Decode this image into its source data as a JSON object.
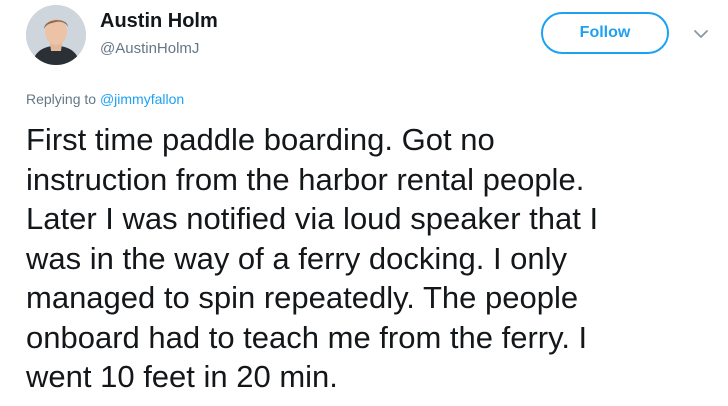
{
  "author": {
    "display_name": "Austin Holm",
    "handle": "@AustinHolmJ",
    "avatar_icon": "profile-photo"
  },
  "actions": {
    "follow_label": "Follow",
    "menu_icon": "chevron-down-icon"
  },
  "reply": {
    "prefix": "Replying to ",
    "mention": "@jimmyfallon"
  },
  "tweet": {
    "lines": [
      "First time paddle boarding. Got no",
      "instruction from the harbor rental people.",
      "Later I was notified via loud speaker that I",
      "was in the way of a ferry docking. I only",
      "managed to spin repeatedly. The people",
      "onboard had to teach me from the ferry. I",
      "went 10 feet in 20 min."
    ]
  },
  "colors": {
    "accent": "#1da1f2",
    "text": "#14171a",
    "muted": "#657786"
  }
}
